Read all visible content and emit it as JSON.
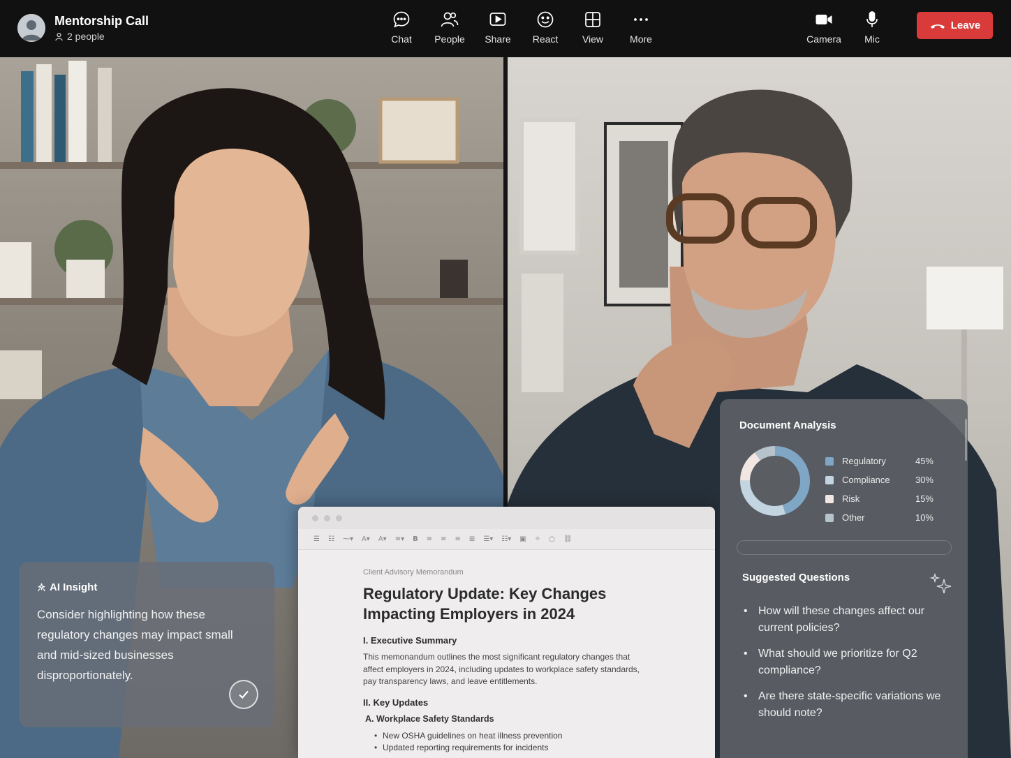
{
  "header": {
    "title": "Mentorship Call",
    "participants": "2 people",
    "tools": [
      {
        "label": "Chat",
        "icon": "chat-icon"
      },
      {
        "label": "People",
        "icon": "people-icon"
      },
      {
        "label": "Share",
        "icon": "share-icon"
      },
      {
        "label": "React",
        "icon": "smile-icon"
      },
      {
        "label": "View",
        "icon": "grid-icon"
      },
      {
        "label": "More",
        "icon": "more-icon"
      }
    ],
    "camera_label": "Camera",
    "mic_label": "Mic",
    "leave_label": "Leave"
  },
  "insight": {
    "heading": "AI Insight",
    "text": "Consider highlighting how these regulatory changes may impact small and mid-sized businesses disproportionately."
  },
  "document": {
    "kicker": "Client Advisory Memorandum",
    "title": "Regulatory Update: Key Changes Impacting Employers in 2024",
    "section1": "I. Executive Summary",
    "paragraph": "This memonandum outlines the most significant regulatory changes that affect employers in 2024, including updates to workplace safety standards, pay transparency laws, and leave entitlements.",
    "section2": "II. Key Updates",
    "subsection": "A. Workplace Safety Standards",
    "bullets": [
      "New OSHA guidelines on heat illness prevention",
      "Updated reporting requirements for incidents"
    ]
  },
  "analysis": {
    "title": "Document Analysis",
    "chart_data": {
      "type": "pie",
      "categories": [
        "Regulatory",
        "Compliance",
        "Risk",
        "Other"
      ],
      "values": [
        45,
        30,
        15,
        10
      ],
      "labels": [
        "45%",
        "30%",
        "15%",
        "10%"
      ],
      "colors": [
        "#7fa6c4",
        "#c2d5e1",
        "#f1e6e2",
        "#b7c3cb"
      ]
    }
  },
  "questions": {
    "title": "Suggested Questions",
    "items": [
      "How will these changes affect our current policies?",
      "What should we prioritize for Q2 compliance?",
      "Are there state-specific variations we should note?"
    ]
  },
  "colors": {
    "leave": "#d93a3a",
    "topbar": "#111111",
    "accent": "#7fa6c4"
  }
}
